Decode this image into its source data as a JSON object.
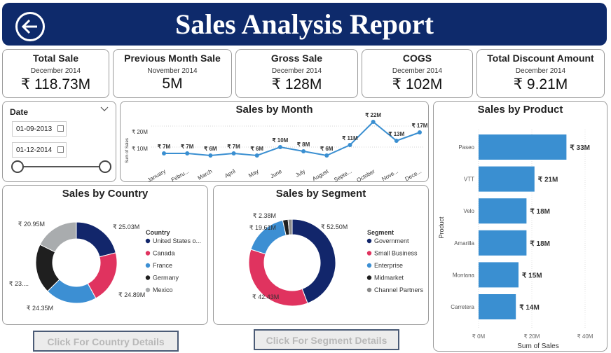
{
  "header": {
    "title": "Sales Analysis Report"
  },
  "kpis": [
    {
      "title": "Total Sale",
      "sub": "December 2014",
      "value": "₹ 118.73M"
    },
    {
      "title": "Previous Month Sale",
      "sub": "November 2014",
      "value": "5M"
    },
    {
      "title": "Gross Sale",
      "sub": "December 2014",
      "value": "₹ 128M"
    },
    {
      "title": "COGS",
      "sub": "December 2014",
      "value": "₹ 102M"
    },
    {
      "title": "Total Discount Amount",
      "sub": "December 2014",
      "value": "₹ 9.21M"
    }
  ],
  "date_slicer": {
    "label": "Date",
    "start": "01-09-2013",
    "end": "01-12-2014"
  },
  "buttons": {
    "country": "Click For Country Details",
    "segment": "Click For Segment Details"
  },
  "colors": {
    "header": "#0e2a6b",
    "bar": "#3a8fd1",
    "line": "#3a8fd1"
  },
  "chart_data": [
    {
      "type": "line",
      "title": "Sales by Month",
      "ylabel": "Sum of Sales",
      "y_ticks": [
        "₹ 20M",
        "₹ 10M"
      ],
      "categories": [
        "January",
        "Febru...",
        "March",
        "April",
        "May",
        "June",
        "July",
        "August",
        "Septe...",
        "October",
        "Nove...",
        "Dece..."
      ],
      "values": [
        7,
        7,
        6,
        7,
        6,
        10,
        8,
        6,
        11,
        22,
        13,
        17
      ],
      "value_labels": [
        "₹ 7M",
        "₹ 7M",
        "₹ 6M",
        "₹ 7M",
        "₹ 6M",
        "₹ 10M",
        "₹ 8M",
        "₹ 6M",
        "₹ 11M",
        "₹ 22M",
        "₹ 13M",
        "₹ 17M"
      ],
      "ylim": [
        0,
        25
      ],
      "grid": true
    },
    {
      "type": "bar",
      "orientation": "horizontal",
      "title": "Sales by Product",
      "xlabel": "Sum of Sales",
      "ylabel": "Product",
      "categories": [
        "Paseo",
        "VTT",
        "Velo",
        "Amarilla",
        "Montana",
        "Carretera"
      ],
      "values": [
        33,
        21,
        18,
        18,
        15,
        14
      ],
      "value_labels": [
        "₹ 33M",
        "₹ 21M",
        "₹ 18M",
        "₹ 18M",
        "₹ 15M",
        "₹ 14M"
      ],
      "x_ticks": [
        "₹ 0M",
        "₹ 20M",
        "₹ 40M"
      ],
      "xlim": [
        0,
        40
      ],
      "grid": true
    },
    {
      "type": "pie",
      "donut": true,
      "title": "Sales by Country",
      "legend_title": "Country",
      "legend_position": "right",
      "categories": [
        "United States o...",
        "Canada",
        "France",
        "Germany",
        "Mexico"
      ],
      "values": [
        25.03,
        24.89,
        24.35,
        23.5,
        20.95
      ],
      "value_labels": [
        "₹ 25.03M",
        "₹ 24.89M",
        "₹ 24.35M",
        "₹ 23....",
        "₹ 20.95M"
      ],
      "colors": [
        "#12266b",
        "#e0335f",
        "#3c8fd3",
        "#1f1f1f",
        "#a9acae"
      ]
    },
    {
      "type": "pie",
      "donut": true,
      "title": "Sales by Segment",
      "legend_title": "Segment",
      "legend_position": "right",
      "categories": [
        "Government",
        "Small Business",
        "Enterprise",
        "Midmarket",
        "Channel Partners"
      ],
      "values": [
        52.5,
        42.43,
        19.61,
        2.38,
        1.81
      ],
      "value_labels": [
        "₹ 52.50M",
        "₹ 42.43M",
        "₹ 19.61M",
        "₹ 2.38M",
        ""
      ],
      "colors": [
        "#12266b",
        "#e0335f",
        "#3c8fd3",
        "#1f1f1f",
        "#8a8a8a"
      ]
    }
  ]
}
